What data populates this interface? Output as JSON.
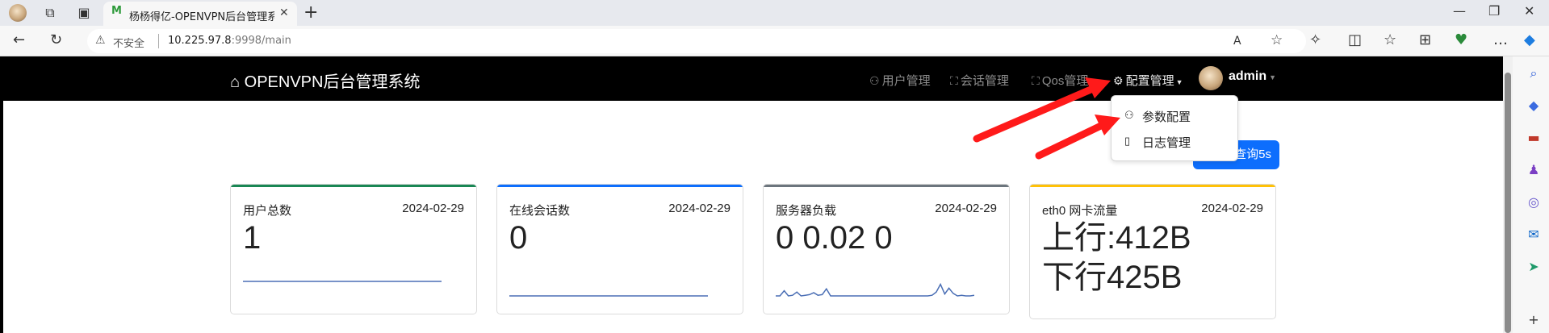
{
  "browser": {
    "tab_title": "杨杨得亿-OPENVPN后台管理系统",
    "tab_favicon": "M",
    "new_tab": "+",
    "insecure_label": "不安全",
    "url_host": "10.225.97.8",
    "url_path": ":9998/main",
    "icons": [
      "profile-avatar-icon",
      "workspaces-icon",
      "tab-actions-icon",
      "back-icon",
      "refresh-icon",
      "warning-icon",
      "read-aloud-icon",
      "favorite-star-icon",
      "extensions-icon",
      "split-screen-icon",
      "favorites-icon",
      "collections-icon",
      "performance-icon",
      "more-icon",
      "copilot-icon"
    ]
  },
  "nav": {
    "brand": "OPENVPN后台管理系统",
    "items": [
      {
        "label": "用户管理",
        "icon": "person-add-icon"
      },
      {
        "label": "会话管理",
        "icon": "fullscreen-icon"
      },
      {
        "label": "Qos管理",
        "icon": "fullscreen-icon"
      },
      {
        "label": "配置管理",
        "icon": "gear-icon"
      }
    ],
    "user": "admin"
  },
  "dropdown": {
    "items": [
      {
        "label": "参数配置",
        "icon": "person-gear-icon"
      },
      {
        "label": "日志管理",
        "icon": "clipboard-icon"
      }
    ]
  },
  "refresh_button": {
    "label": "自动查询5s"
  },
  "cards": [
    {
      "title": "用户总数",
      "date": "2024-02-29",
      "value": "1",
      "accent": "#198754"
    },
    {
      "title": "在线会话数",
      "date": "2024-02-29",
      "value": "0",
      "accent": "#0d6efd"
    },
    {
      "title": "服务器负载",
      "date": "2024-02-29",
      "value": "0 0.02 0",
      "accent": "#6c757d"
    },
    {
      "title": "eth0 网卡流量",
      "date": "2024-02-29",
      "value_up": "上行:412B",
      "value_down": "下行425B",
      "accent": "#ffc107"
    }
  ],
  "sparkline_color": "#4b6fb5",
  "sparklines": {
    "users": [
      1,
      1,
      1,
      1,
      1,
      1,
      1,
      1,
      1,
      1,
      1,
      1,
      1,
      1,
      1,
      1,
      1,
      1,
      1,
      1
    ],
    "sessions": [
      0,
      0,
      0,
      0,
      0,
      0,
      0,
      0,
      0,
      0,
      0,
      0,
      0,
      0,
      0,
      0,
      0,
      0,
      0,
      0
    ],
    "load": [
      0,
      0,
      0.8,
      0,
      0.1,
      0.6,
      0,
      0.1,
      0.2,
      0.5,
      0.1,
      0.2,
      1.1,
      0,
      0,
      0,
      0,
      0,
      0,
      0,
      0,
      0,
      0,
      0,
      0,
      0,
      0,
      0,
      0,
      0,
      0,
      0,
      0,
      0,
      0,
      0,
      0,
      0.1,
      0.6,
      1.8,
      0.3,
      1.2,
      0.4,
      0,
      0.1,
      0,
      0,
      0.1
    ]
  },
  "annotation_color": "#ff1a1a"
}
